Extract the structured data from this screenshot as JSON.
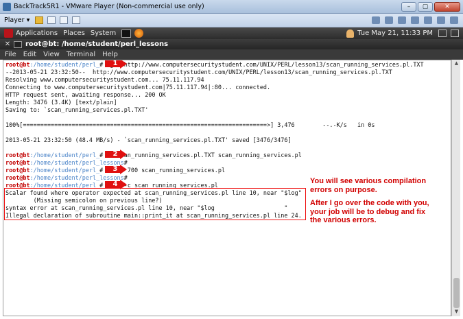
{
  "window": {
    "title": "BackTrack5R1 - VMware Player (Non-commercial use only)",
    "controls": [
      "–",
      "▢",
      "✕"
    ]
  },
  "vm_toolbar": {
    "player_label": "Player ▾"
  },
  "gnome_panel": {
    "applications": "Applications",
    "places": "Places",
    "system": "System",
    "clock": "Tue May 21, 11:33 PM"
  },
  "terminal": {
    "title": "root@bt: /home/student/perl_lessons",
    "menu": [
      "File",
      "Edit",
      "View",
      "Terminal",
      "Help"
    ],
    "lines": [
      {
        "user": "root@bt",
        "path": ":/home/student/perl_",
        "cmd": "# wget http://www.computersecuritystudent.com/UNIX/PERL/lesson13/scan_running_services.pl.TXT"
      },
      {
        "text": "--2013-05-21 23:32:50--  http://www.computersecuritystudent.com/UNIX/PERL/lesson13/scan_running_services.pl.TXT"
      },
      {
        "text": "Resolving www.computersecuritystudent.com... 75.11.117.94"
      },
      {
        "text": "Connecting to www.computersecuritystudent.com|75.11.117.94|:80... connected."
      },
      {
        "text": "HTTP request sent, awaiting response... 200 OK"
      },
      {
        "text": "Length: 3476 (3.4K) [text/plain]"
      },
      {
        "text": "Saving to: `scan_running_services.pl.TXT'"
      },
      {
        "text": ""
      },
      {
        "text": "100%[======================================================================>] 3,476        --.-K/s   in 0s"
      },
      {
        "text": ""
      },
      {
        "text": "2013-05-21 23:32:50 (48.4 MB/s) - `scan_running_services.pl.TXT' saved [3476/3476]"
      },
      {
        "text": ""
      },
      {
        "user": "root@bt",
        "path": ":/home/student/perl_",
        "cmd": "# mv scan_running_services.pl.TXT scan_running_services.pl"
      },
      {
        "user": "root@bt",
        "path": ":/home/student/perl_lessons",
        "cmd": "#"
      },
      {
        "user": "root@bt",
        "path": ":/home/student/perl_",
        "cmd": "# chmod 700 scan_running_services.pl"
      },
      {
        "user": "root@bt",
        "path": ":/home/student/perl_lessons",
        "cmd": "#"
      },
      {
        "user": "root@bt",
        "path": ":/home/student/perl_",
        "cmd": "# perl -c scan_running_services.pl"
      },
      {
        "text": "Scalar found where operator expected at scan_running_services.pl line 10, near \"$log\""
      },
      {
        "text": "        (Missing semicolon on previous line?)"
      },
      {
        "text": "syntax error at scan_running_services.pl line 10, near \"$log                    \""
      },
      {
        "text": "Illegal declaration of subroutine main::print_it at scan_running_services.pl line 24."
      }
    ]
  },
  "callouts": [
    "1",
    "2",
    "3",
    "4"
  ],
  "annotation": {
    "line1": "You will see various compilation",
    "line2": "errors on purpose.",
    "line3": "After I go over the code with you,",
    "line4": "your job will be to debug and fix",
    "line5": "the various errors."
  },
  "colors": {
    "prompt_user": "#c00000",
    "prompt_path": "#4b84c8",
    "callout": "#e01010",
    "annotation": "#d10000"
  }
}
